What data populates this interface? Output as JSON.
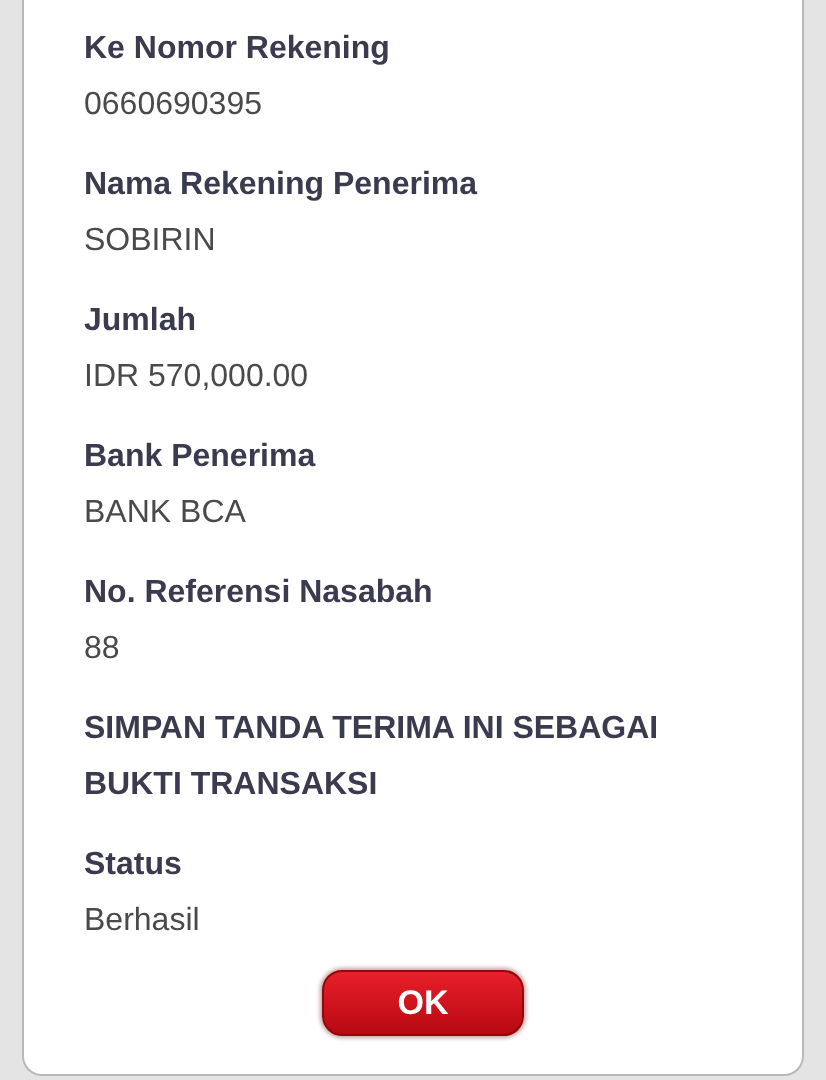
{
  "fields": [
    {
      "label": "Ke Nomor Rekening",
      "value": "0660690395"
    },
    {
      "label": "Nama Rekening Penerima",
      "value": "SOBIRIN"
    },
    {
      "label": "Jumlah",
      "value": "IDR 570,000.00"
    },
    {
      "label": "Bank Penerima",
      "value": "BANK BCA"
    },
    {
      "label": "No. Referensi Nasabah",
      "value": "88"
    }
  ],
  "notice": "SIMPAN TANDA TERIMA INI SEBAGAI BUKTI TRANSAKSI",
  "status": {
    "label": "Status",
    "value": "Berhasil"
  },
  "buttons": [
    "OK"
  ]
}
